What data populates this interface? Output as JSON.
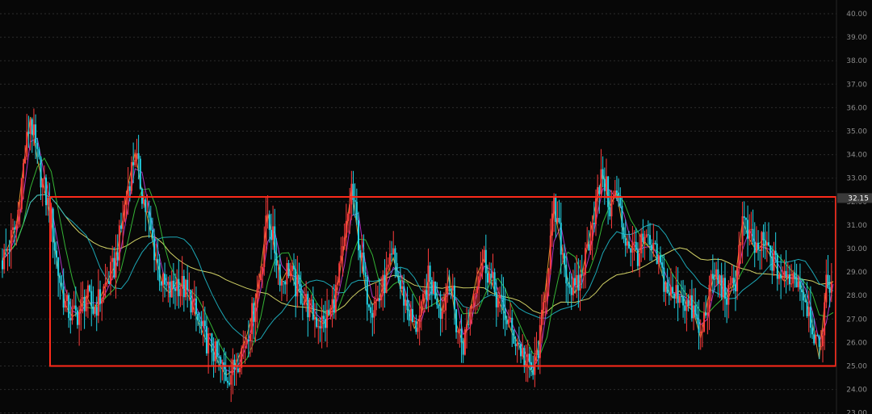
{
  "chart_data": {
    "type": "candlestick",
    "y_axis": {
      "min": 23,
      "max": 40,
      "ticks": [
        "23.00",
        "24.00",
        "25.00",
        "26.00",
        "27.00",
        "28.00",
        "29.00",
        "30.00",
        "31.00",
        "32.00",
        "33.00",
        "34.00",
        "35.00",
        "36.00",
        "37.00",
        "38.00",
        "39.00",
        "40.00"
      ],
      "position": "right",
      "grid": "dotted horizontal"
    },
    "last_price": {
      "value": 32.15,
      "label": "32.15"
    },
    "range_box": {
      "top_value": 32.2,
      "bottom_value": 25.0,
      "color": "#ff2a1a"
    },
    "close_series": [
      29.5,
      30.2,
      31.0,
      33.5,
      35.6,
      33.8,
      32.5,
      31.2,
      29.0,
      27.6,
      27.1,
      27.3,
      28.0,
      27.4,
      27.9,
      28.6,
      29.2,
      30.8,
      32.7,
      34.1,
      32.4,
      31.0,
      29.6,
      28.4,
      28.1,
      28.6,
      28.3,
      27.8,
      26.9,
      26.2,
      25.8,
      25.1,
      24.6,
      24.8,
      25.5,
      26.3,
      27.4,
      29.1,
      31.5,
      30.0,
      28.6,
      29.2,
      28.4,
      28.0,
      27.4,
      27.0,
      26.8,
      27.3,
      28.4,
      30.2,
      32.6,
      30.4,
      28.3,
      27.6,
      27.9,
      28.8,
      29.6,
      28.3,
      27.5,
      26.6,
      27.2,
      28.7,
      28.2,
      27.3,
      28.9,
      26.8,
      25.9,
      27.4,
      28.9,
      29.6,
      28.6,
      27.8,
      27.2,
      26.4,
      25.9,
      25.1,
      24.7,
      26.2,
      28.9,
      31.7,
      30.2,
      28.6,
      28.1,
      28.9,
      30.4,
      31.9,
      33.2,
      31.8,
      32.4,
      30.6,
      30.1,
      29.8,
      30.3,
      29.9,
      29.4,
      28.4,
      27.9,
      28.2,
      27.6,
      27.3,
      26.2,
      27.8,
      28.9,
      28.4,
      27.9,
      28.7,
      31.2,
      30.4,
      29.9,
      30.2,
      29.7,
      29.1,
      28.6,
      28.9,
      28.7,
      27.9,
      26.8,
      25.3,
      28.4,
      28.6
    ],
    "series": [
      {
        "color": "#e8e870",
        "ma": 60
      },
      {
        "color": "#1fb8c8",
        "ma": 30
      },
      {
        "color": "#3ac83a",
        "ma": 12
      },
      {
        "color": "#c23ad6",
        "ma": 6
      },
      {
        "color": "#e8a030",
        "ma": 3
      }
    ],
    "candle_colors": {
      "up": "#ff3c3c",
      "down": "#22d4e6"
    }
  }
}
